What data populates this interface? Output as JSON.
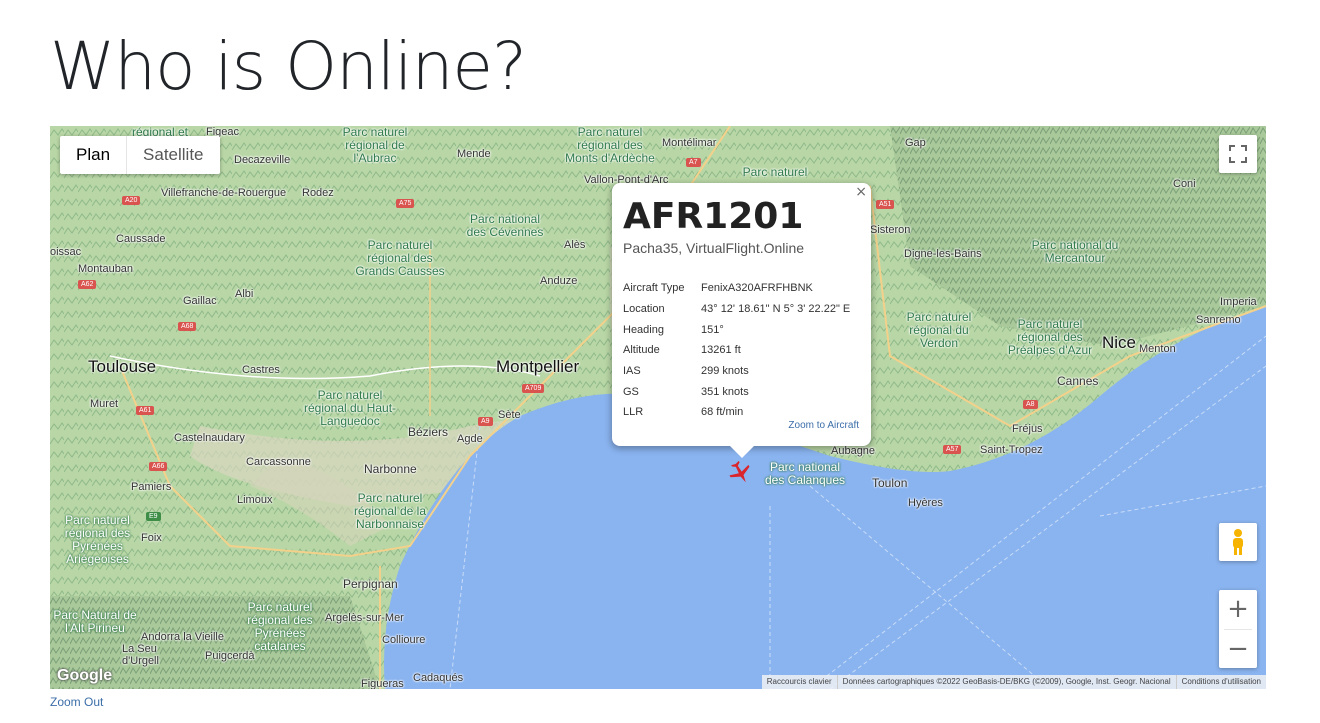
{
  "page": {
    "title": "Who is Online?"
  },
  "map": {
    "maptype": {
      "plan": "Plan",
      "satellite": "Satellite"
    },
    "zoom": {
      "in": "+",
      "out": "−"
    },
    "attribution": {
      "shortcuts": "Raccourcis clavier",
      "data": "Données cartographiques ©2022 GeoBasis-DE/BKG (©2009), Google, Inst. Geogr. Nacional",
      "terms": "Conditions d'utilisation"
    },
    "logo": "Google",
    "places": {
      "toulouse": "Toulouse",
      "montpellier": "Montpellier",
      "nice": "Nice",
      "cannes": "Cannes",
      "montauban": "Montauban",
      "narbonne": "Narbonne",
      "perpignan": "Perpignan",
      "beziers": "Béziers",
      "carcassonne": "Carcassonne",
      "albi": "Albi",
      "toulon": "Toulon",
      "hyeres": "Hyères",
      "frejus": "Fréjus",
      "st_tropez": "Saint-Tropez",
      "digne": "Digne-les-Bains",
      "gap": "Gap",
      "ales": "Alès",
      "sete": "Sète",
      "agde": "Agde",
      "castres": "Castres",
      "gaillac": "Gaillac",
      "rodez": "Rodez",
      "mende": "Mende",
      "figeac": "Figeac",
      "decazeville": "Decazeville",
      "villefranche": "Villefranche-de-Rouergue",
      "caussade": "Caussade",
      "muret": "Muret",
      "castelnaudary": "Castelnaudary",
      "limoux": "Limoux",
      "pamiers": "Pamiers",
      "foix": "Foix",
      "argeles": "Argelès-sur-Mer",
      "collioure": "Collioure",
      "andorra": "Andorra la Vieille",
      "seu": "La Seu d'Urgell",
      "puigcerda": "Puigcerdà",
      "figueras": "Figueras",
      "cadaques": "Cadaqués",
      "anduze": "Anduze",
      "montelimar": "Montélimar",
      "vallon": "Vallon-Pont-d'Arc",
      "sisteron": "Sisteron",
      "coni": "Coni",
      "menton": "Menton",
      "sanremo": "Sanremo",
      "imperia": "Imperia",
      "aubagne": "Aubagne",
      "moissac": "oissac"
    },
    "parks": {
      "cevennes": "Parc national des Cévennes",
      "grands_causses": "Parc naturel régional des Grands Causses",
      "haut_languedoc": "Parc naturel régional du Haut-Languedoc",
      "narbonnaise": "Parc naturel régional de la Narbonnaise",
      "aubrac": "Parc naturel régional de l'Aubrac",
      "ardeche": "Parc naturel régional des Monts d'Ardèche",
      "verdon": "Parc naturel régional du Verdon",
      "prealpes": "Parc naturel régional des Préalpes d'Azur",
      "mercantour": "Parc national du Mercantour",
      "calanques": "Parc national des Calanques",
      "pyrenees_ariegeoises": "Parc naturel régional des Pyrénées Ariégeoises",
      "pyrenees_catalanes": "Parc naturel régional des Pyrénées catalanes",
      "pirineu": "Parc Natural de l'Alt Pirineu",
      "regional_et": "régional et",
      "lyon_park": "Parc naturel"
    },
    "roads": [
      "A20",
      "A75",
      "A62",
      "A68",
      "A61",
      "A66",
      "A9",
      "A709",
      "A7",
      "A51",
      "A8",
      "A57",
      "E9"
    ]
  },
  "infowindow": {
    "callsign": "AFR1201",
    "subtitle": "Pacha35, VirtualFlight.Online",
    "close": "×",
    "rows": [
      {
        "k": "Aircraft Type",
        "v": "FenixA320AFRFHBNK"
      },
      {
        "k": "Location",
        "v": "43° 12' 18.61\" N 5° 3' 22.22\" E"
      },
      {
        "k": "Heading",
        "v": "151°"
      },
      {
        "k": "Altitude",
        "v": "13261 ft"
      },
      {
        "k": "IAS",
        "v": "299 knots"
      },
      {
        "k": "GS",
        "v": "351 knots"
      },
      {
        "k": "LLR",
        "v": "68 ft/min"
      }
    ],
    "zoom_link": "Zoom to Aircraft"
  },
  "footer": {
    "zoom_out": "Zoom Out"
  },
  "colors": {
    "sea": "#8ab4f0",
    "land": "#b8d8a8",
    "aircraft": "#d9252b",
    "link": "#3c6ea8"
  },
  "icons": {
    "fullscreen": "fullscreen-icon",
    "pegman": "pegman-icon",
    "aircraft": "aircraft-icon",
    "close": "close-icon"
  }
}
